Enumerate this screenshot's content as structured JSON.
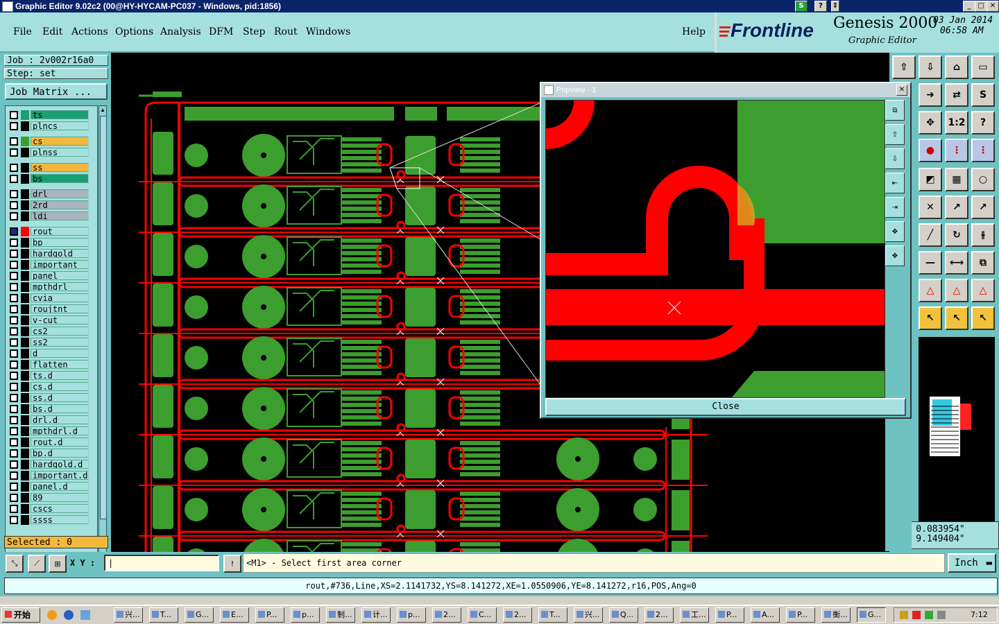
{
  "window": {
    "title": "Graphic Editor 9.02c2 (00@HY-HYCAM-PC037 - Windows, pid:1856)"
  },
  "menu": {
    "items": [
      "File",
      "Edit",
      "Actions",
      "Options",
      "Analysis",
      "DFM",
      "Step",
      "Rout",
      "Windows"
    ],
    "help": "Help"
  },
  "brand": {
    "name": "Frontline",
    "product": "Genesis 2000",
    "subtitle": "Graphic Editor",
    "date": "03 Jan 2014",
    "time": "06:58 AM"
  },
  "job": {
    "job_label": "Job : 2v002r16a0",
    "step_label": "Step: set",
    "matrix_button": "Job Matrix ..."
  },
  "layers": [
    {
      "name": "ts",
      "color": "#1a9e74",
      "highlight": "#1a9e74"
    },
    {
      "name": "plncs",
      "color": "#000000",
      "highlight": ""
    },
    {
      "name": "cs",
      "color": "#3c9e2e",
      "highlight": "#f2b83c"
    },
    {
      "name": "plnss",
      "color": "#000000",
      "highlight": ""
    },
    {
      "name": "ss",
      "color": "#000000",
      "highlight": "#f2b83c"
    },
    {
      "name": "bs",
      "color": "#000000",
      "highlight": "#1a9e74"
    },
    {
      "name": "drl",
      "color": "#000000",
      "highlight": "#a9b4bf"
    },
    {
      "name": "2rd",
      "color": "#000000",
      "highlight": "#a9b4bf"
    },
    {
      "name": "ldi",
      "color": "#000000",
      "highlight": "#a9b4bf"
    },
    {
      "name": "rout",
      "color": "#ff0000",
      "highlight": ""
    },
    {
      "name": "bp",
      "color": "#000000",
      "highlight": ""
    },
    {
      "name": "hardgold",
      "color": "#000000",
      "highlight": ""
    },
    {
      "name": "important",
      "color": "#000000",
      "highlight": ""
    },
    {
      "name": "panel",
      "color": "#000000",
      "highlight": ""
    },
    {
      "name": "mpthdrl",
      "color": "#000000",
      "highlight": ""
    },
    {
      "name": "cvia",
      "color": "#000000",
      "highlight": ""
    },
    {
      "name": "roujtnt",
      "color": "#000000",
      "highlight": ""
    },
    {
      "name": "v-cut",
      "color": "#000000",
      "highlight": ""
    },
    {
      "name": "cs2",
      "color": "#000000",
      "highlight": ""
    },
    {
      "name": "ss2",
      "color": "#000000",
      "highlight": ""
    },
    {
      "name": "d",
      "color": "#000000",
      "highlight": ""
    },
    {
      "name": "flatten",
      "color": "#000000",
      "highlight": ""
    },
    {
      "name": "ts.d",
      "color": "#000000",
      "highlight": ""
    },
    {
      "name": "cs.d",
      "color": "#000000",
      "highlight": ""
    },
    {
      "name": "ss.d",
      "color": "#000000",
      "highlight": ""
    },
    {
      "name": "bs.d",
      "color": "#000000",
      "highlight": ""
    },
    {
      "name": "drl.d",
      "color": "#000000",
      "highlight": ""
    },
    {
      "name": "mpthdrl.d",
      "color": "#000000",
      "highlight": ""
    },
    {
      "name": "rout.d",
      "color": "#000000",
      "highlight": ""
    },
    {
      "name": "bp.d",
      "color": "#000000",
      "highlight": ""
    },
    {
      "name": "hardgold.d",
      "color": "#000000",
      "highlight": ""
    },
    {
      "name": "important.d",
      "color": "#000000",
      "highlight": ""
    },
    {
      "name": "panel.d",
      "color": "#000000",
      "highlight": ""
    },
    {
      "name": "89",
      "color": "#000000",
      "highlight": ""
    },
    {
      "name": "cscs",
      "color": "#000000",
      "highlight": ""
    },
    {
      "name": "ssss",
      "color": "#000000",
      "highlight": ""
    }
  ],
  "selected": "Selected : 0",
  "popview": {
    "title": "Popview - 1",
    "close_label": "Close"
  },
  "coords": {
    "x": "X = 0.083954\"",
    "y": "Y = 9.149404\""
  },
  "command": {
    "xy_label": "X Y :",
    "prompt": "<M1> - Select first area corner",
    "units": "Inch"
  },
  "status": "rout,#736,Line,XS=2.1141732,YS=8.141272,XE=1.0550906,YE=8.141272,r16,POS,Ang=0",
  "taskbar": {
    "start": "开始",
    "tasks": [
      "兴...",
      "T...",
      "G...",
      "E...",
      "P...",
      "p...",
      "制...",
      "计...",
      "p...",
      "2...",
      "C...",
      "2...",
      "T...",
      "兴...",
      "Q...",
      "2...",
      "工...",
      "P...",
      "A...",
      "P...",
      "衡...",
      "G..."
    ],
    "clock": "7:12"
  },
  "colors": {
    "copper": "#3c9e2e",
    "rout": "#ff0000",
    "panel": "#a5e0de",
    "frame": "#6fc2c2"
  }
}
